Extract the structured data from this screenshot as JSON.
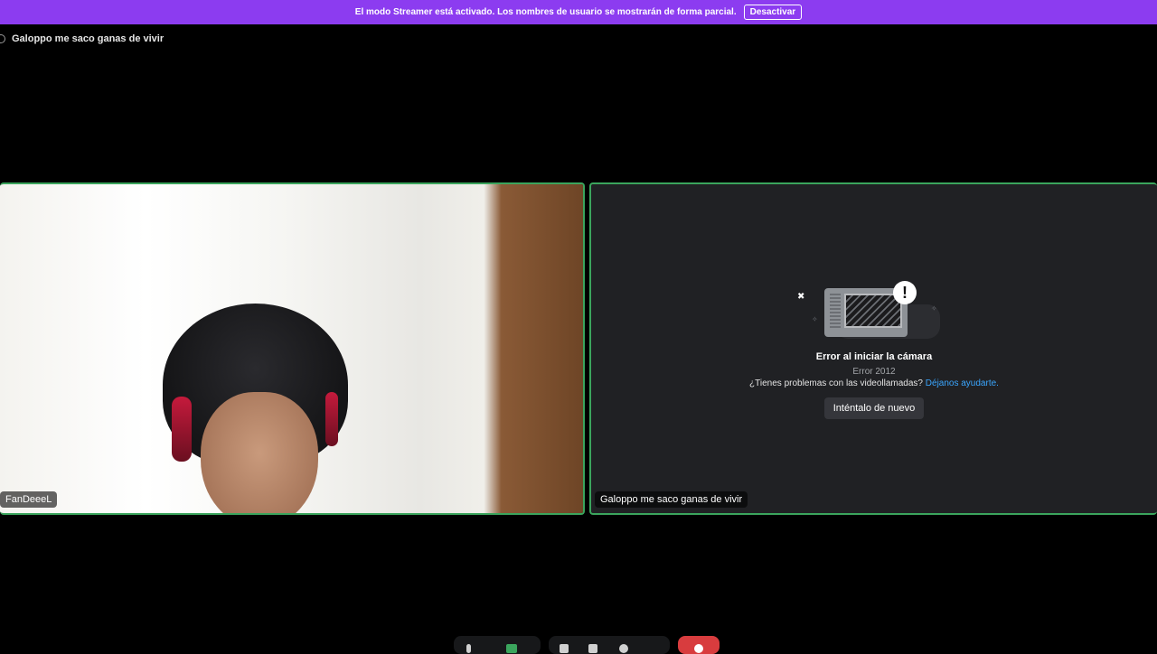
{
  "banner": {
    "message": "El modo Streamer está activado. Los nombres de usuario se mostrarán de forma parcial.",
    "button_label": "Desactivar"
  },
  "channel": {
    "name": "Galoppo me saco ganas de vivir"
  },
  "tiles": {
    "left": {
      "user_name": "FanDeeeL"
    },
    "right": {
      "user_name": "Galoppo me saco ganas de vivir",
      "error_title": "Error al iniciar la cámara",
      "error_code": "Error 2012",
      "help_text": "¿Tienes problemas con las videollamadas?",
      "help_link": "Déjanos ayudarte.",
      "retry_label": "Inténtalo de nuevo"
    }
  },
  "colors": {
    "banner": "#8c3cf0",
    "speaking_border": "#3ba55d",
    "end_call": "#d83c3e",
    "link": "#3aa6ff"
  },
  "controls": {
    "icons": [
      "microphone-icon",
      "camera-icon",
      "screen-share-icon",
      "activity-icon",
      "soundboard-icon",
      "end-call-icon"
    ]
  }
}
